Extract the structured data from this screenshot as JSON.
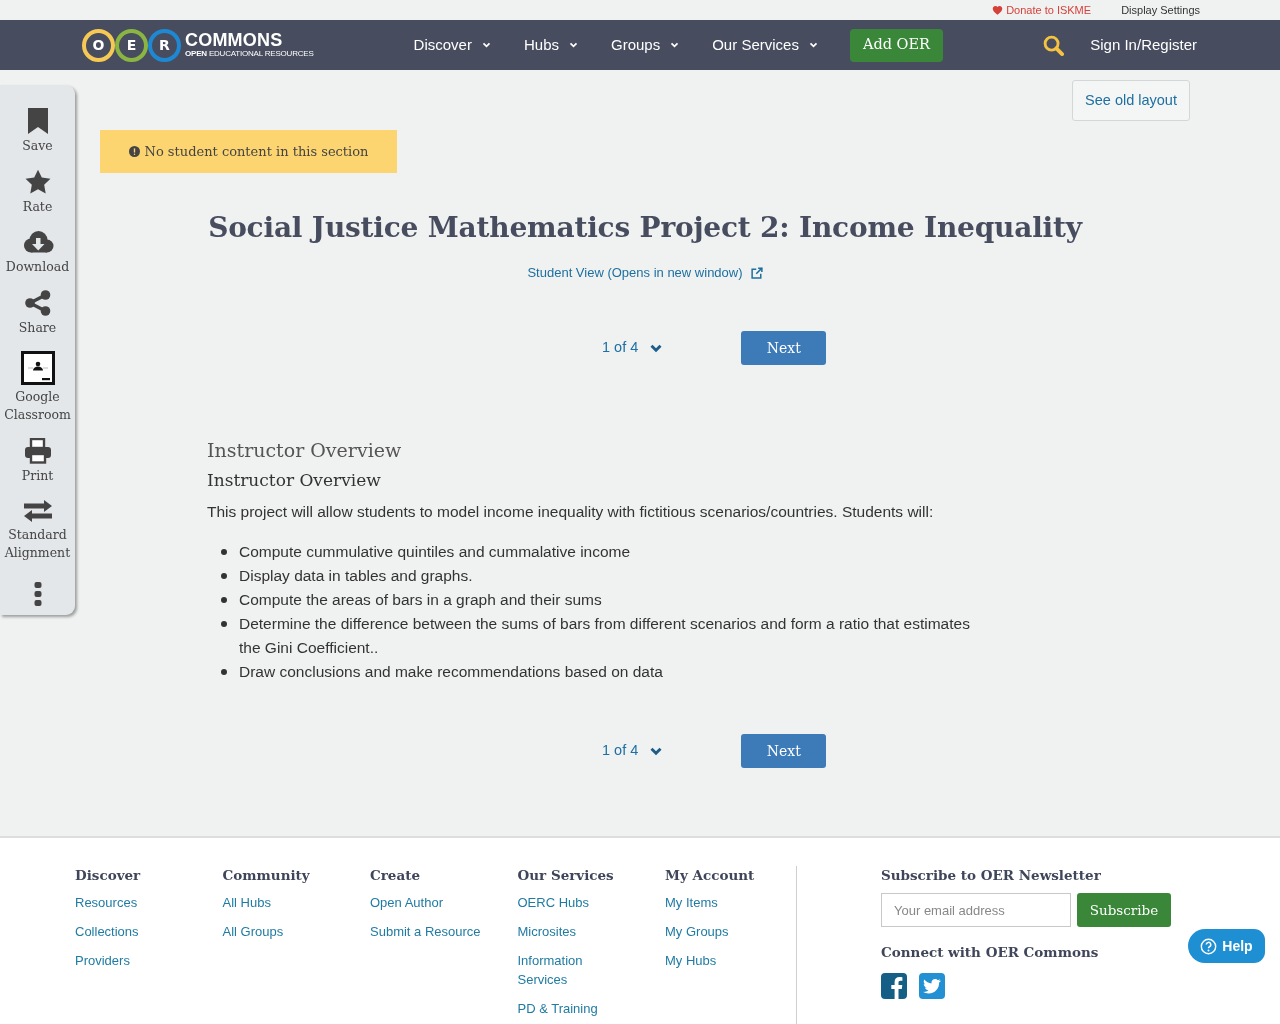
{
  "top_links": [
    {
      "label": "Donate to ISKME",
      "kind": "donate"
    },
    {
      "label": "Display Settings",
      "kind": "settings"
    }
  ],
  "navbar": {
    "logo": {
      "letters": [
        {
          "letter": "O",
          "color": "#f6c955"
        },
        {
          "letter": "E",
          "color": "#8ab542"
        },
        {
          "letter": "R",
          "color": "#1e88d2"
        }
      ],
      "wordmark": "COMMONS",
      "tagline": "**OPEN** EDUCATIONAL RESOURCES"
    },
    "menu": [
      "Discover",
      "Hubs",
      "Groups",
      "Our Services"
    ],
    "add_button": "Add OER",
    "account_link": "Sign In/Register"
  },
  "sidebar": {
    "items": [
      {
        "kind": "save",
        "label": "Save"
      },
      {
        "kind": "rate",
        "label": "Rate"
      },
      {
        "kind": "download",
        "label": "Download"
      },
      {
        "kind": "share",
        "label": "Share"
      },
      {
        "kind": "classroom",
        "label": "Google Classroom"
      },
      {
        "kind": "print",
        "label": "Print"
      },
      {
        "kind": "alignment",
        "label": "Standard Alignment"
      },
      {
        "kind": "more"
      }
    ]
  },
  "old_layout_button": "See old layout",
  "notice": "No student content in this section",
  "title": "Social Justice Mathematics Project 2: Income Inequality",
  "student_view_link": "Student View (Opens in new window)",
  "pagers": [
    {
      "position": "1 of 4",
      "next_button": "Next"
    },
    {
      "position": "1 of 4",
      "next_button": "Next"
    }
  ],
  "section": {
    "heading": "Instructor Overview",
    "subheading": "Instructor Overview",
    "intro": "This project will allow students to model income inequality with fictitious scenarios/countries. Students will:",
    "bullets": [
      "Compute cummulative quintiles and cummalative income",
      "Display data in tables and graphs.",
      "Compute the areas of bars in a graph and their sums",
      "Determine the difference between the sums of bars from different scenarios and form a ratio that estimates the Gini Coefficient..",
      "Draw conclusions and make recommendations based on data"
    ]
  },
  "footer": {
    "columns": [
      {
        "heading": "Discover",
        "links": [
          "Resources",
          "Collections",
          "Providers"
        ]
      },
      {
        "heading": "Community",
        "links": [
          "All Hubs",
          "All Groups"
        ]
      },
      {
        "heading": "Create",
        "links": [
          "Open Author",
          "Submit a Resource"
        ]
      },
      {
        "heading": "Our Services",
        "links": [
          "OERC Hubs",
          "Microsites",
          "Information Services",
          "PD & Training"
        ]
      },
      {
        "heading": "My Account",
        "links": [
          "My Items",
          "My Groups",
          "My Hubs"
        ]
      }
    ],
    "newsletter": {
      "heading": "Subscribe to OER Newsletter",
      "placeholder": "Your email address",
      "button": "Subscribe"
    },
    "connect": {
      "heading": "Connect with OER Commons",
      "networks": [
        {
          "kind": "facebook"
        },
        {
          "kind": "twitter"
        }
      ]
    }
  },
  "help_button": "Help"
}
